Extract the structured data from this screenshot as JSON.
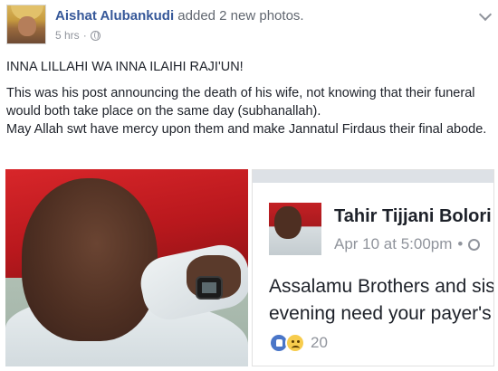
{
  "header": {
    "author_name": "Aishat Alubankudi",
    "action_text": "added 2 new photos.",
    "time": "5 hrs",
    "separator": "·",
    "privacy_icon": "globe-icon",
    "options_icon": "chevron-down-icon"
  },
  "body": {
    "line1": "INNA LILLAHI WA INNA ILAIHI RAJI'UN!",
    "paragraph2": "This was his post announcing the death of his wife, not knowing that their funeral would both take place on the same day (subhanallah).",
    "paragraph3": "May Allah swt have mercy upon them and make Jannatul Firdaus their final abode."
  },
  "shared_post": {
    "author_name": "Tahir Tijjani Bolori",
    "date": "Apr 10 at 5:00pm",
    "separator": "•",
    "text_line1": "Assalamu Brothers and sis",
    "text_line2": "evening need your payer's",
    "reaction_icons": [
      "like-icon",
      "sad-icon"
    ],
    "reaction_count": "20"
  },
  "colors": {
    "link_blue": "#365899",
    "meta_gray": "#90949c",
    "text_dark": "#1d2129"
  }
}
